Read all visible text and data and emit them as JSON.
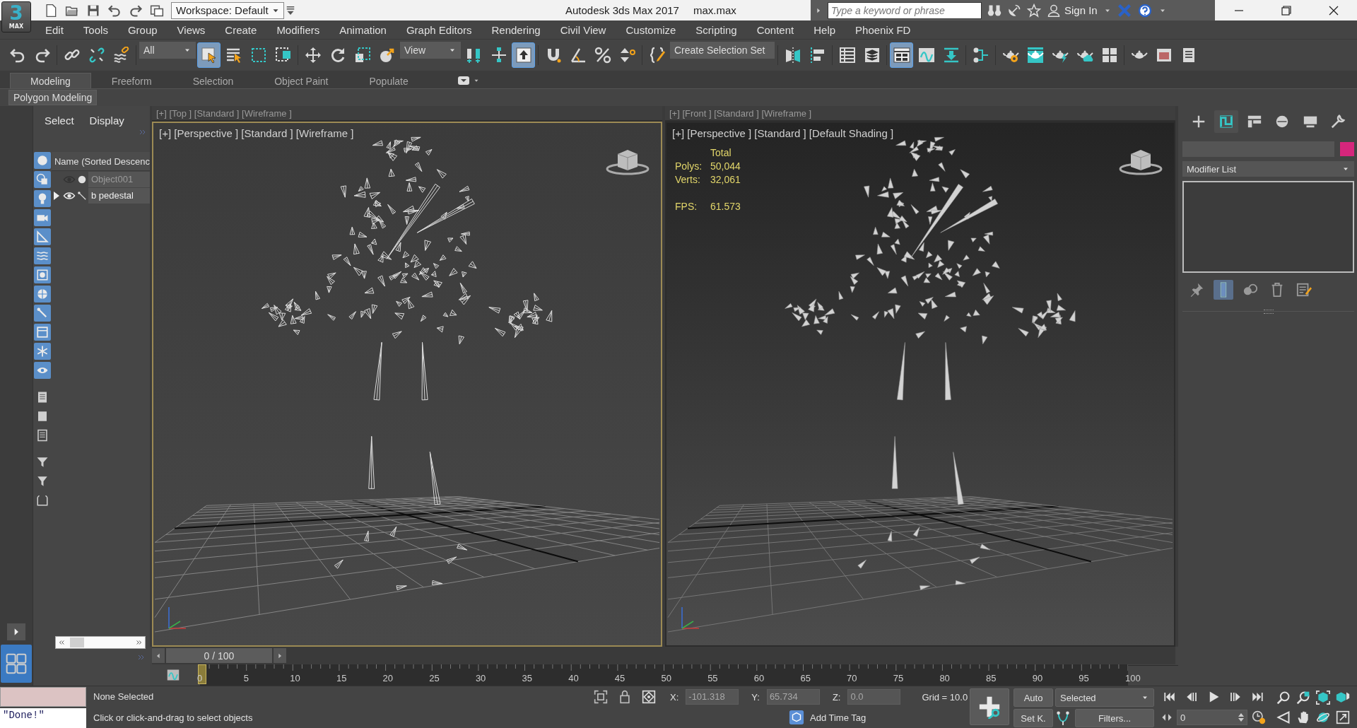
{
  "title_bar": {
    "logo": {
      "mark": "3",
      "label": "MAX"
    },
    "workspace": "Workspace: Default",
    "title": "Autodesk 3ds Max 2017",
    "file": "max.max",
    "search": {
      "placeholder": "Type a keyword or phrase"
    },
    "sign_in": "Sign In"
  },
  "menu": [
    "Edit",
    "Tools",
    "Group",
    "Views",
    "Create",
    "Modifiers",
    "Animation",
    "Graph Editors",
    "Rendering",
    "Civil View",
    "Customize",
    "Scripting",
    "Content",
    "Help",
    "Phoenix FD"
  ],
  "toolbar": [
    {
      "kind": "undo",
      "selected": false
    },
    {
      "kind": "redo",
      "selected": false
    },
    {
      "kind": "sep"
    },
    {
      "kind": "link",
      "selected": false
    },
    {
      "kind": "unlink",
      "selected": false
    },
    {
      "kind": "bind",
      "selected": false
    },
    {
      "kind": "sep"
    },
    {
      "kind": "dropdown",
      "value": "All"
    },
    {
      "kind": "select",
      "selected": true
    },
    {
      "kind": "select-name",
      "selected": false
    },
    {
      "kind": "rect-region",
      "selected": false
    },
    {
      "kind": "crossing",
      "selected": false
    },
    {
      "kind": "sep"
    },
    {
      "kind": "move",
      "selected": false
    },
    {
      "kind": "rotate",
      "selected": false
    },
    {
      "kind": "scale",
      "selected": false
    },
    {
      "kind": "place",
      "selected": false
    },
    {
      "kind": "dropdown",
      "value": "View"
    },
    {
      "kind": "pivot",
      "selected": false
    },
    {
      "kind": "manip",
      "selected": false
    },
    {
      "kind": "up-arrow",
      "selected": true
    },
    {
      "kind": "sep"
    },
    {
      "kind": "snap",
      "selected": false
    },
    {
      "kind": "angle",
      "selected": false
    },
    {
      "kind": "percent",
      "selected": false
    },
    {
      "kind": "spinner",
      "selected": false
    },
    {
      "kind": "sep"
    },
    {
      "kind": "edit-sets",
      "selected": false
    },
    {
      "kind": "dropdown",
      "value": "Create Selection Set"
    },
    {
      "kind": "sep"
    },
    {
      "kind": "mirror",
      "selected": false
    },
    {
      "kind": "align",
      "selected": false
    },
    {
      "kind": "sep"
    },
    {
      "kind": "list",
      "selected": false
    },
    {
      "kind": "layers",
      "selected": false
    },
    {
      "kind": "sep"
    },
    {
      "kind": "ribbon",
      "selected": true
    },
    {
      "kind": "curve",
      "selected": false
    },
    {
      "kind": "dope",
      "selected": false
    },
    {
      "kind": "sep"
    },
    {
      "kind": "schematic",
      "selected": false
    },
    {
      "kind": "sep"
    },
    {
      "kind": "teapot-gear",
      "selected": false
    },
    {
      "kind": "teapot-window",
      "selected": false
    },
    {
      "kind": "teapot-bolt",
      "selected": false
    },
    {
      "kind": "teapot-cloud",
      "selected": false
    },
    {
      "kind": "tiles",
      "selected": false
    },
    {
      "kind": "sep"
    },
    {
      "kind": "teapot",
      "selected": false
    },
    {
      "kind": "image-window",
      "selected": false
    },
    {
      "kind": "panel",
      "selected": false
    }
  ],
  "ribbon": {
    "tabs": [
      {
        "label": "Modeling",
        "selected": true
      },
      {
        "label": "Freeform",
        "selected": false
      },
      {
        "label": "Selection",
        "selected": false
      },
      {
        "label": "Object Paint",
        "selected": false
      },
      {
        "label": "Populate",
        "selected": false
      }
    ],
    "panel": "Polygon Modeling"
  },
  "scene_explorer": {
    "tabs": [
      "Select",
      "Display"
    ],
    "column": "Name (Sorted Descenc",
    "filters": [
      {
        "kind": "geometry",
        "on": true
      },
      {
        "kind": "shapes",
        "on": true
      },
      {
        "kind": "lights",
        "on": true
      },
      {
        "kind": "cameras",
        "on": true
      },
      {
        "kind": "helpers",
        "on": true
      },
      {
        "kind": "spacewarps",
        "on": true
      },
      {
        "kind": "groups",
        "on": true
      },
      {
        "kind": "xrefs",
        "on": true
      },
      {
        "kind": "bones",
        "on": true
      },
      {
        "kind": "containers",
        "on": true
      },
      {
        "kind": "frozen",
        "on": true
      },
      {
        "kind": "hidden",
        "on": true
      },
      {
        "kind": "sep"
      },
      {
        "kind": "all",
        "on": false
      },
      {
        "kind": "none",
        "on": false
      },
      {
        "kind": "invert",
        "on": false
      },
      {
        "kind": "sep"
      },
      {
        "kind": "filter",
        "on": false
      },
      {
        "kind": "funnel",
        "on": false
      },
      {
        "kind": "box",
        "on": false
      }
    ],
    "rows": [
      {
        "name": "Object001",
        "kind": "geometry",
        "hidden": true,
        "expandable": false
      },
      {
        "name": "b pedestal",
        "kind": "bone",
        "hidden": false,
        "expandable": true,
        "expanded": false
      }
    ]
  },
  "viewports": {
    "top_labels": [
      "[+] [Top ] [Standard ] [Wireframe ]",
      "[+] [Front ] [Standard ] [Wireframe ]"
    ],
    "views": [
      {
        "label": "[+] [Perspective ] [Standard ] [Wireframe ]",
        "kind": "wireframe",
        "active": true
      },
      {
        "label": "[+] [Perspective ] [Standard ] [Default Shading ]",
        "kind": "shaded",
        "active": false,
        "stats": {
          "header": "Total",
          "rows": [
            {
              "label": "Polys:",
              "value": "50,044"
            },
            {
              "label": "Verts:",
              "value": "32,061"
            }
          ],
          "fps": {
            "label": "FPS:",
            "value": "61.573"
          }
        }
      }
    ]
  },
  "command_panel": {
    "tabs": [
      {
        "kind": "create",
        "selected": false
      },
      {
        "kind": "modify",
        "selected": true
      },
      {
        "kind": "hierarchy",
        "selected": false
      },
      {
        "kind": "motion",
        "selected": false
      },
      {
        "kind": "display",
        "selected": false
      },
      {
        "kind": "utilities",
        "selected": false
      }
    ],
    "color": "#d6267c",
    "modifier_list": "Modifier List",
    "stack_buttons": [
      {
        "kind": "pin",
        "selected": false
      },
      {
        "kind": "end-result",
        "selected": true
      },
      {
        "kind": "unique",
        "selected": false
      },
      {
        "kind": "trash",
        "selected": false
      },
      {
        "kind": "configure",
        "selected": false
      }
    ]
  },
  "time_slider": {
    "label": "0 / 100"
  },
  "track_bar": {
    "ticks": [
      "0",
      "5",
      "10",
      "15",
      "20",
      "25",
      "30",
      "35",
      "40",
      "45",
      "50",
      "55",
      "60",
      "65",
      "70",
      "75",
      "80",
      "85",
      "90",
      "95",
      "100"
    ]
  },
  "status_bar": {
    "listener_output": "\"Done!\"",
    "selection": "None Selected",
    "prompt": "Click or click-and-drag to select objects",
    "coords": [
      {
        "axis": "X:",
        "value": "-101.318"
      },
      {
        "axis": "Y:",
        "value": "65.734"
      },
      {
        "axis": "Z:",
        "value": "0.0"
      }
    ],
    "grid": "Grid = 10.0",
    "time_tag": "Add Time Tag",
    "auto_key": "Auto",
    "set_key": "Set K.",
    "key_mode": "Selected",
    "filters": "Filters...",
    "frame": "0"
  }
}
